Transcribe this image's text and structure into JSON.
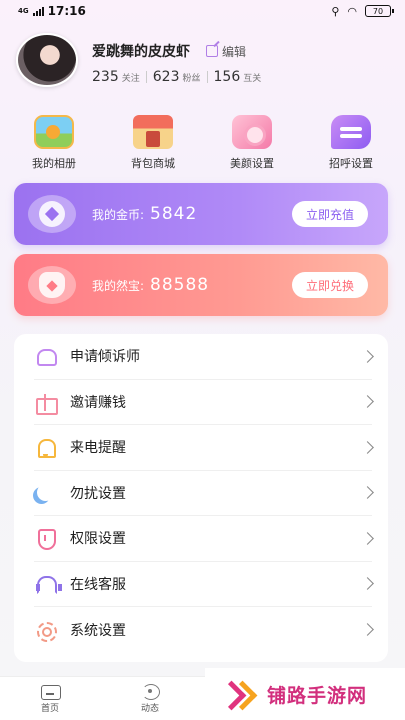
{
  "status": {
    "network": "4G",
    "time": "17:16",
    "battery": "70"
  },
  "profile": {
    "name": "爱跳舞的皮皮虾",
    "edit_label": "编辑",
    "stats": [
      {
        "value": "235",
        "label": "关注"
      },
      {
        "value": "623",
        "label": "粉丝"
      },
      {
        "value": "156",
        "label": "互关"
      }
    ]
  },
  "quick_actions": [
    {
      "label": "我的相册",
      "icon": "album-icon"
    },
    {
      "label": "背包商城",
      "icon": "shop-icon"
    },
    {
      "label": "美颜设置",
      "icon": "beauty-icon"
    },
    {
      "label": "招呼设置",
      "icon": "greeting-icon"
    }
  ],
  "coins": {
    "label": "我的金币:",
    "value": "5842",
    "button": "立即充值",
    "color": "#9b72f0"
  },
  "treasure": {
    "label": "我的然宝:",
    "value": "88588",
    "button": "立即兑换",
    "color": "#ff7b86"
  },
  "menu": [
    {
      "label": "申请倾诉师",
      "icon": "heart-icon"
    },
    {
      "label": "邀请赚钱",
      "icon": "gift-icon"
    },
    {
      "label": "来电提醒",
      "icon": "bell-icon"
    },
    {
      "label": "勿扰设置",
      "icon": "moon-icon"
    },
    {
      "label": "权限设置",
      "icon": "shield-icon"
    },
    {
      "label": "在线客服",
      "icon": "headset-icon"
    },
    {
      "label": "系统设置",
      "icon": "gear-icon"
    }
  ],
  "tabs": [
    {
      "label": "首页",
      "icon": "home-icon"
    },
    {
      "label": "动态",
      "icon": "feed-icon"
    }
  ],
  "watermark": {
    "text": "铺路手游网"
  }
}
